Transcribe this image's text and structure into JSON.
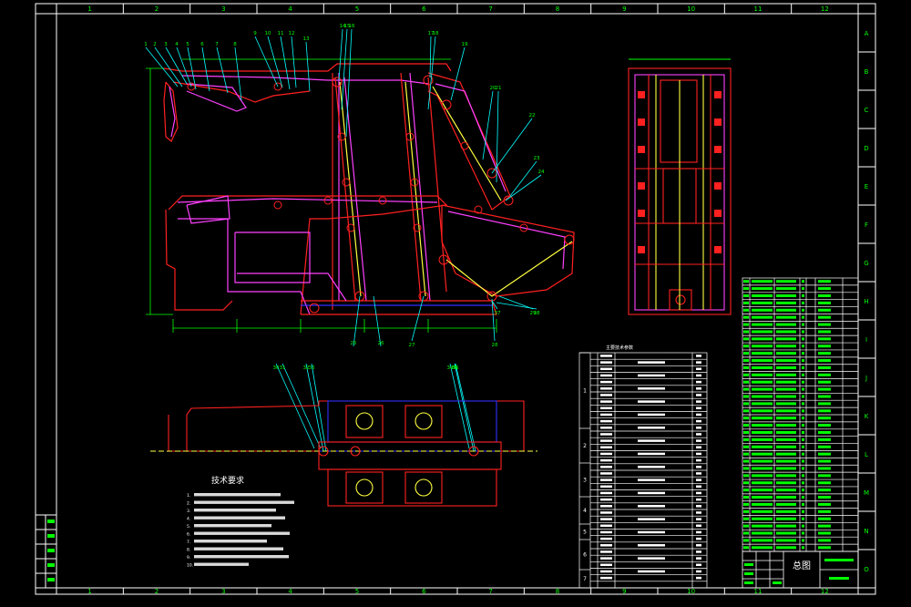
{
  "colors": {
    "background": "#000000",
    "frame": "#ffffff",
    "grid_text": "#00ff00",
    "red": "#ff2020",
    "magenta": "#ff40ff",
    "yellow": "#ffff40",
    "cyan": "#00ffff",
    "green": "#00ff00",
    "blue": "#3030ff",
    "white": "#ffffff"
  },
  "frame": {
    "col_labels": [
      "1",
      "2",
      "3",
      "4",
      "5",
      "6",
      "7",
      "8",
      "9",
      "10",
      "11",
      "12"
    ],
    "row_labels": [
      "A",
      "B",
      "C",
      "D",
      "E",
      "F",
      "G",
      "H",
      "I",
      "J",
      "K",
      "L",
      "M",
      "N",
      "O"
    ]
  },
  "balloons_top": [
    "1",
    "2",
    "3",
    "4",
    "5",
    "6",
    "7",
    "8",
    "9",
    "10",
    "11",
    "12",
    "13",
    "14",
    "15",
    "16",
    "17",
    "18",
    "19",
    "20",
    "21",
    "22",
    "23",
    "24",
    "25",
    "26"
  ],
  "balloons_bottom": [
    "27",
    "28",
    "29",
    "30",
    "31",
    "32",
    "33",
    "34",
    "35",
    "36",
    "37",
    "38"
  ],
  "technical_requirements": {
    "title": "技术要求",
    "items": [
      "1.",
      "2.",
      "3.",
      "4.",
      "5.",
      "6.",
      "7.",
      "8.",
      "9.",
      "10."
    ]
  },
  "params_table": {
    "title": "主要技术参数",
    "group_labels": [
      "1",
      "2",
      "3",
      "4",
      "5",
      "6",
      "7"
    ]
  },
  "title_block": {
    "drawing_name": "总图"
  },
  "left_margin_block": {
    "rows": [
      "",
      "",
      "",
      "",
      ""
    ]
  }
}
